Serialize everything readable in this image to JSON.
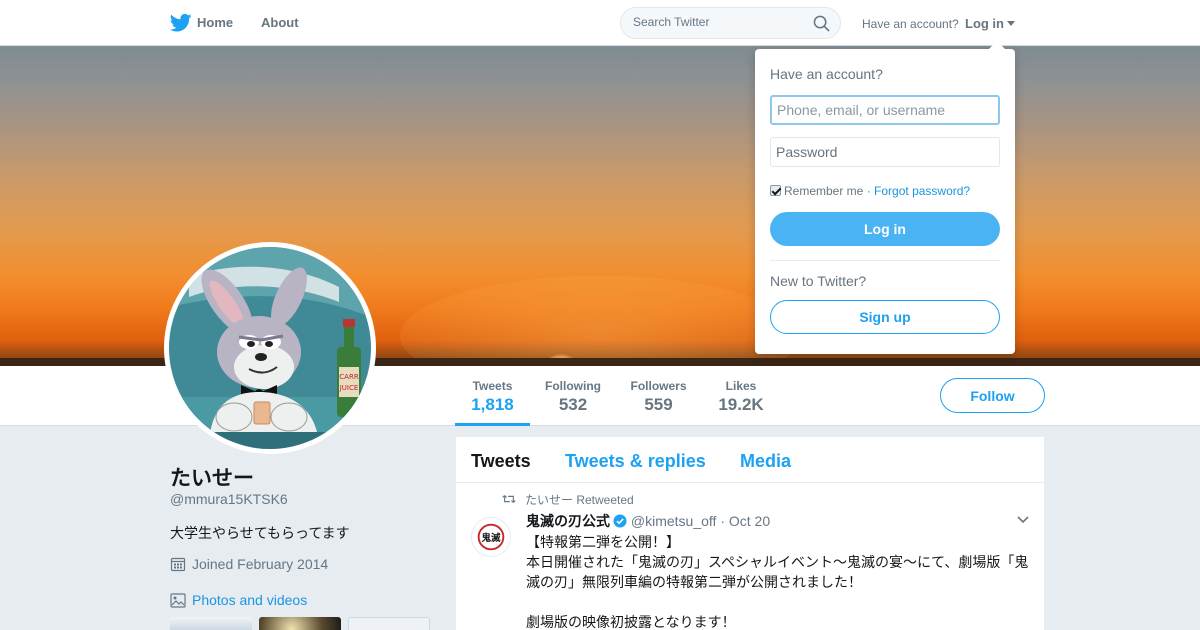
{
  "nav": {
    "home_label": "Home",
    "about_label": "About",
    "search_placeholder": "Search Twitter",
    "have_account": "Have an account?",
    "login_label": "Log in",
    "brand_color": "#1da1f2"
  },
  "profile": {
    "name": "たいせー",
    "handle": "@mmura15KTSK6",
    "bio": "大学生やらせてもらってます",
    "joined": "Joined February 2014",
    "photos_label": "Photos and videos",
    "follow_label": "Follow"
  },
  "stats": [
    {
      "label": "Tweets",
      "value": "1,818",
      "active": true
    },
    {
      "label": "Following",
      "value": "532"
    },
    {
      "label": "Followers",
      "value": "559"
    },
    {
      "label": "Likes",
      "value": "19.2K"
    }
  ],
  "timeline": {
    "tabs": [
      {
        "label": "Tweets",
        "active": true
      },
      {
        "label": "Tweets & replies"
      },
      {
        "label": "Media"
      }
    ],
    "tweet": {
      "retweet_context": "たいせー Retweeted",
      "author_name": "鬼滅の刃公式",
      "author_handle": "@kimetsu_off",
      "dot": "·",
      "date": "Oct 20",
      "avatar_text": "鬼滅",
      "lines": [
        "【特報第二弾を公開！】",
        "本日開催された「鬼滅の刃」スペシャルイベント～鬼滅の宴～にて、劇場版「鬼滅の刃」無限列車編の特報第二弾が公開されました！",
        "劇場版の映像初披露となります！"
      ]
    }
  },
  "login_dropdown": {
    "title": "Have an account?",
    "username_placeholder": "Phone, email, or username",
    "password_placeholder": "Password",
    "remember_label": "Remember me",
    "separator": "·",
    "forgot_label": "Forgot password?",
    "login_button": "Log in",
    "new_to_twitter": "New to Twitter?",
    "signup_button": "Sign up"
  }
}
